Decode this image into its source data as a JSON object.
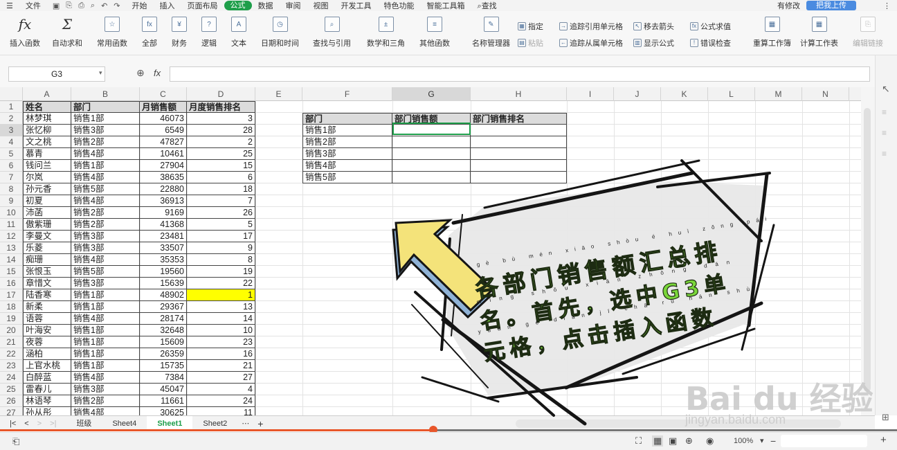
{
  "menubar": {
    "file": "文件",
    "tabs": [
      "开始",
      "插入",
      "页面布局",
      "公式",
      "数据",
      "审阅",
      "视图",
      "开发工具",
      "特色功能",
      "智能工具箱"
    ],
    "active_tab": "公式",
    "search": "查找",
    "cloud_status": "有修改",
    "upload_label": "把我上传"
  },
  "ribbon": {
    "insert_fn": "插入函数",
    "buttons": [
      "自动求和",
      "常用函数",
      "全部",
      "财务",
      "逻辑",
      "文本",
      "日期和时间",
      "查找与引用",
      "数学和三角",
      "其他函数"
    ],
    "name_manager": "名称管理器",
    "specify": "指定",
    "paste": "粘贴",
    "trace_precedents": "追踪引用单元格",
    "trace_dependents": "追踪从属单元格",
    "remove_arrows": "移去箭头",
    "show_formulas": "显示公式",
    "evaluate": "公式求值",
    "error_check": "错误检查",
    "recalc_workbook": "重算工作簿",
    "calc_sheet": "计算工作表",
    "edit_links": "编辑链接"
  },
  "formula_bar": {
    "name_box": "G3",
    "fx": "fx",
    "value": ""
  },
  "columns": [
    "A",
    "B",
    "C",
    "D",
    "E",
    "F",
    "G",
    "H",
    "I",
    "J",
    "K",
    "L",
    "M",
    "N"
  ],
  "selected_col": "G",
  "selected_row": "3",
  "table1": {
    "headers": [
      "姓名",
      "部门",
      "月销售额",
      "月度销售排名"
    ],
    "rows": [
      [
        "林梦琪",
        "销售1部",
        "46073",
        "3"
      ],
      [
        "张忆柳",
        "销售3部",
        "6549",
        "28"
      ],
      [
        "文之桃",
        "销售2部",
        "47827",
        "2"
      ],
      [
        "慕青",
        "销售4部",
        "10461",
        "25"
      ],
      [
        "钱问兰",
        "销售1部",
        "27904",
        "15"
      ],
      [
        "尔岚",
        "销售4部",
        "38635",
        "6"
      ],
      [
        "孙元香",
        "销售5部",
        "22880",
        "18"
      ],
      [
        "初夏",
        "销售4部",
        "36913",
        "7"
      ],
      [
        "沛菡",
        "销售2部",
        "9169",
        "26"
      ],
      [
        "傲紫珊",
        "销售2部",
        "41368",
        "5"
      ],
      [
        "李曼文",
        "销售3部",
        "23481",
        "17"
      ],
      [
        "乐菱",
        "销售3部",
        "33507",
        "9"
      ],
      [
        "痴珊",
        "销售4部",
        "35353",
        "8"
      ],
      [
        "张恨玉",
        "销售5部",
        "19560",
        "19"
      ],
      [
        "章惜文",
        "销售3部",
        "15639",
        "22"
      ],
      [
        "陆香寒",
        "销售1部",
        "48902",
        "1"
      ],
      [
        "新柔",
        "销售1部",
        "29367",
        "13"
      ],
      [
        "语蓉",
        "销售4部",
        "28174",
        "14"
      ],
      [
        "叶海安",
        "销售1部",
        "32648",
        "10"
      ],
      [
        "夜蓉",
        "销售1部",
        "15609",
        "23"
      ],
      [
        "涵柏",
        "销售1部",
        "26359",
        "16"
      ],
      [
        "上官水桃",
        "销售1部",
        "15735",
        "21"
      ],
      [
        "白醉蓝",
        "销售4部",
        "7384",
        "27"
      ],
      [
        "雷春儿",
        "销售3部",
        "45047",
        "4"
      ],
      [
        "林语琴",
        "销售2部",
        "11661",
        "24"
      ],
      [
        "孙从彤",
        "销售4部",
        "30625",
        "11"
      ]
    ],
    "highlight_value": "1"
  },
  "table2": {
    "headers": [
      "部门",
      "部门销售额",
      "部门销售排名"
    ],
    "rows": [
      "销售1部",
      "销售2部",
      "销售3部",
      "销售4部",
      "销售5部"
    ]
  },
  "sheet_tabs": [
    "班级",
    "Sheet4",
    "Sheet1",
    "Sheet2"
  ],
  "active_sheet": "Sheet1",
  "status": {
    "zoom": "100%"
  },
  "annotation": {
    "line1": "各部门销售额汇总排",
    "line2": "名。首先，选中G3单",
    "line3": "元格，点击插入函数",
    "pinyin1": "gè bù mén xiāo shòu é huì zǒng pái",
    "pinyin2": "míng shǒu xiān zhōng dān",
    "pinyin3": "yuán gé diǎn jī chā rù hán shù",
    "colors": {
      "text": "#7ad63a",
      "arrow": "#f4e37a",
      "shadow": "#8fb2d6"
    }
  },
  "watermark": {
    "logo": "Bai du 经验",
    "url": "jingyan.baidu.com"
  }
}
